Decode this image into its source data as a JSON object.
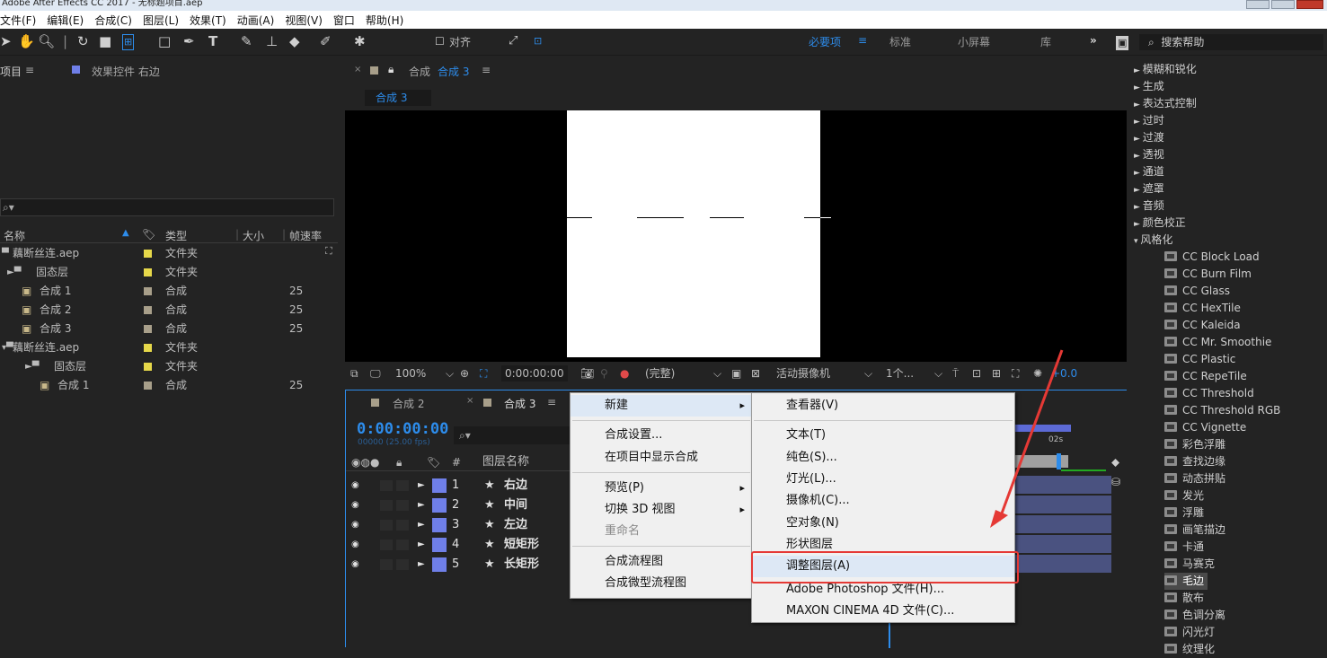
{
  "window": {
    "title": "Adobe After Effects CC 2017 - 无标题项目.aep"
  },
  "menu": [
    "文件(F)",
    "编辑(E)",
    "合成(C)",
    "图层(L)",
    "效果(T)",
    "动画(A)",
    "视图(V)",
    "窗口",
    "帮助(H)"
  ],
  "toolbar": {
    "align_label": "对齐",
    "workspaces": [
      "必要项",
      "标准",
      "小屏幕",
      "库"
    ],
    "more": "»",
    "search_placeholder": "搜索帮助"
  },
  "project_panel": {
    "tab_project": "项目",
    "tab_effect_controls": "效果控件 右边",
    "search_placeholder": "",
    "columns": [
      "名称",
      "类型",
      "大小",
      "帧速率"
    ],
    "rows": [
      {
        "name": "藕断丝连.aep",
        "type": "文件夹",
        "fps": "",
        "color": "#e6d84a",
        "kind": "folder",
        "indent": 0
      },
      {
        "name": "固态层",
        "type": "文件夹",
        "fps": "",
        "color": "#e6d84a",
        "kind": "folder",
        "indent": 1
      },
      {
        "name": "合成 1",
        "type": "合成",
        "fps": "25",
        "color": "#a89f8a",
        "kind": "comp",
        "indent": 1
      },
      {
        "name": "合成 2",
        "type": "合成",
        "fps": "25",
        "color": "#a89f8a",
        "kind": "comp",
        "indent": 1
      },
      {
        "name": "合成 3",
        "type": "合成",
        "fps": "25",
        "color": "#a89f8a",
        "kind": "comp",
        "indent": 1
      },
      {
        "name": "藕断丝连.aep",
        "type": "文件夹",
        "fps": "",
        "color": "#e6d84a",
        "kind": "folder",
        "indent": 0
      },
      {
        "name": "固态层",
        "type": "文件夹",
        "fps": "",
        "color": "#e6d84a",
        "kind": "folder",
        "indent": 2
      },
      {
        "name": "合成 1",
        "type": "合成",
        "fps": "25",
        "color": "#a89f8a",
        "kind": "comp",
        "indent": 2
      }
    ]
  },
  "composition_panel": {
    "tab_label": "合成",
    "tab_comp_name": "合成 3",
    "breadcrumb": "合成 3",
    "zoom": "100%",
    "timecode": "0:00:00:00",
    "resolution": "(完整)",
    "camera": "活动摄像机",
    "views": "1个...",
    "exposure": "+0.0"
  },
  "timeline_panel": {
    "tabs": [
      "合成 2",
      "合成 3"
    ],
    "timecode": "0:00:00:00",
    "frames": "00000 (25.00 fps)",
    "columns": [
      "#",
      "图层名称"
    ],
    "ruler_label": "02s",
    "layers": [
      {
        "num": "1",
        "name": "右边"
      },
      {
        "num": "2",
        "name": "中间"
      },
      {
        "num": "3",
        "name": "左边"
      },
      {
        "num": "4",
        "name": "短矩形"
      },
      {
        "num": "5",
        "name": "长矩形"
      }
    ]
  },
  "context_menu": {
    "items": [
      {
        "label": "新建",
        "submenu": true,
        "enabled": true
      },
      {
        "label": "合成设置...",
        "submenu": false,
        "enabled": true
      },
      {
        "label": "在项目中显示合成",
        "submenu": false,
        "enabled": true
      },
      {
        "label": "预览(P)",
        "submenu": true,
        "enabled": true
      },
      {
        "label": "切换 3D 视图",
        "submenu": true,
        "enabled": true
      },
      {
        "label": "重命名",
        "submenu": false,
        "enabled": false
      },
      {
        "label": "合成流程图",
        "submenu": false,
        "enabled": true
      },
      {
        "label": "合成微型流程图",
        "submenu": false,
        "enabled": true
      }
    ]
  },
  "submenu": {
    "items": [
      "查看器(V)",
      "文本(T)",
      "纯色(S)...",
      "灯光(L)...",
      "摄像机(C)...",
      "空对象(N)",
      "形状图层",
      "调整图层(A)",
      "Adobe Photoshop 文件(H)...",
      "MAXON CINEMA 4D 文件(C)..."
    ],
    "highlighted": "调整图层(A)"
  },
  "effects_panel": {
    "categories": [
      "模糊和锐化",
      "生成",
      "表达式控制",
      "过时",
      "过渡",
      "透视",
      "通道",
      "遮罩",
      "音频",
      "颜色校正"
    ],
    "expanded": "风格化",
    "effects": [
      "CC Block Load",
      "CC Burn Film",
      "CC Glass",
      "CC HexTile",
      "CC Kaleida",
      "CC Mr. Smoothie",
      "CC Plastic",
      "CC RepeTile",
      "CC Threshold",
      "CC Threshold RGB",
      "CC Vignette",
      "彩色浮雕",
      "查找边缘",
      "动态拼贴",
      "发光",
      "浮雕",
      "画笔描边",
      "卡通",
      "马赛克",
      "毛边",
      "散布",
      "色调分离",
      "闪光灯",
      "纹理化"
    ],
    "selected": "毛边"
  },
  "colors": {
    "accent": "#2d8ceb",
    "label_blue": "#6f7fe8",
    "highlight": "#e53935"
  }
}
